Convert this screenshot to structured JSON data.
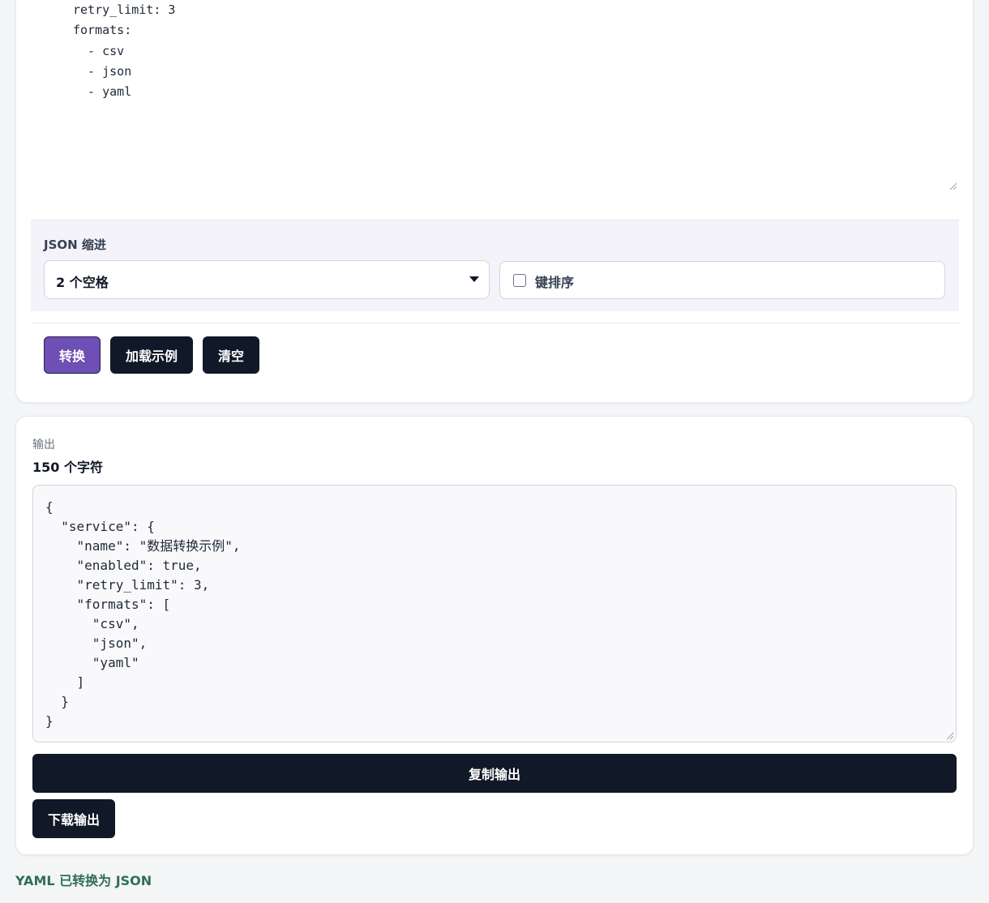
{
  "input": {
    "yaml_lines": [
      "retry_limit: 3",
      "formats:",
      "  - csv",
      "  - json",
      "  - yaml"
    ]
  },
  "options": {
    "indent_label": "JSON 缩进",
    "indent_selected": "2 个空格",
    "sort_keys_label": "键排序",
    "sort_keys_checked": false
  },
  "actions": {
    "convert": "转换",
    "load_example": "加载示例",
    "clear": "清空"
  },
  "output": {
    "label": "输出",
    "char_count": "150 个字符",
    "json_lines": [
      "{",
      "  \"service\": {",
      "    \"name\": \"数据转换示例\",",
      "    \"enabled\": true,",
      "    \"retry_limit\": 3,",
      "    \"formats\": [",
      "      \"csv\",",
      "      \"json\",",
      "      \"yaml\"",
      "    ]",
      "  }",
      "}"
    ],
    "copy_button": "复制输出",
    "download_button": "下载输出"
  },
  "status": {
    "message": "YAML 已转换为 JSON",
    "color": "#2f6f55"
  },
  "colors": {
    "primary": "#6d4fb5",
    "dark": "#111827"
  }
}
